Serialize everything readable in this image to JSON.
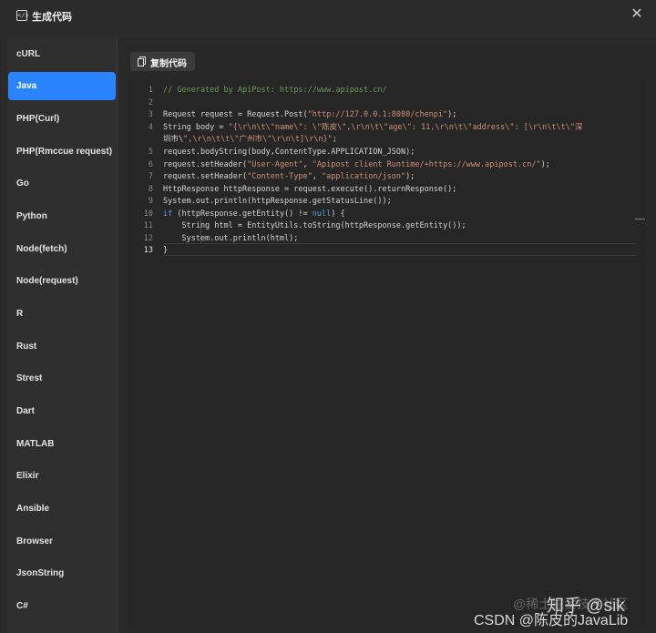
{
  "window": {
    "title": "生成代码",
    "title_icon": "code-icon",
    "close_icon": "close-icon"
  },
  "sidebar": {
    "items": [
      {
        "label": "cURL",
        "active": false
      },
      {
        "label": "Java",
        "active": true
      },
      {
        "label": "PHP(Curl)",
        "active": false
      },
      {
        "label": "PHP(Rmccue request)",
        "active": false
      },
      {
        "label": "Go",
        "active": false
      },
      {
        "label": "Python",
        "active": false
      },
      {
        "label": "Node(fetch)",
        "active": false
      },
      {
        "label": "Node(request)",
        "active": false
      },
      {
        "label": "R",
        "active": false
      },
      {
        "label": "Rust",
        "active": false
      },
      {
        "label": "Strest",
        "active": false
      },
      {
        "label": "Dart",
        "active": false
      },
      {
        "label": "MATLAB",
        "active": false
      },
      {
        "label": "Elixir",
        "active": false
      },
      {
        "label": "Ansible",
        "active": false
      },
      {
        "label": "Browser",
        "active": false
      },
      {
        "label": "JsonString",
        "active": false
      },
      {
        "label": "C#",
        "active": false
      }
    ]
  },
  "toolbar": {
    "copy_label": "复制代码",
    "copy_icon": "copy-icon"
  },
  "editor": {
    "line_numbers": [
      "1",
      "2",
      "3",
      "4",
      "",
      "5",
      "6",
      "7",
      "8",
      "9",
      "10",
      "11",
      "12",
      "13"
    ],
    "current_line": "13",
    "lines": [
      "// Generated by ApiPost: https://www.apipost.cn/",
      "",
      "Request request = Request.Post(\"http://127.0.0.1:8080/chenpi\");",
      "String body = \"{\\r\\n\\t\\\"name\\\": \\\"陈皮\\\",\\r\\n\\t\\\"age\\\": 11,\\r\\n\\t\\\"address\\\": [\\r\\n\\t\\t\\\"深",
      "圳市\\\",\\r\\n\\t\\t\\\"广州市\\\"\\r\\n\\t]\\r\\n}\";",
      "request.bodyString(body,ContentType.APPLICATION_JSON);",
      "request.setHeader(\"User-Agent\", \"Apipost client Runtime/+https://www.apipost.cn/\");",
      "request.setHeader(\"Content-Type\", \"application/json\");",
      "HttpResponse httpResponse = request.execute().returnResponse();",
      "System.out.println(httpResponse.getStatusLine());",
      "if (httpResponse.getEntity() != null) {",
      "    String html = EntityUtils.toString(httpResponse.getEntity());",
      "    System.out.println(html);",
      "}"
    ]
  },
  "watermarks": {
    "juejin": "@稀土掘金技术社区",
    "zhihu": "知乎 @sik",
    "csdn": "CSDN @陈皮的JavaLib"
  }
}
